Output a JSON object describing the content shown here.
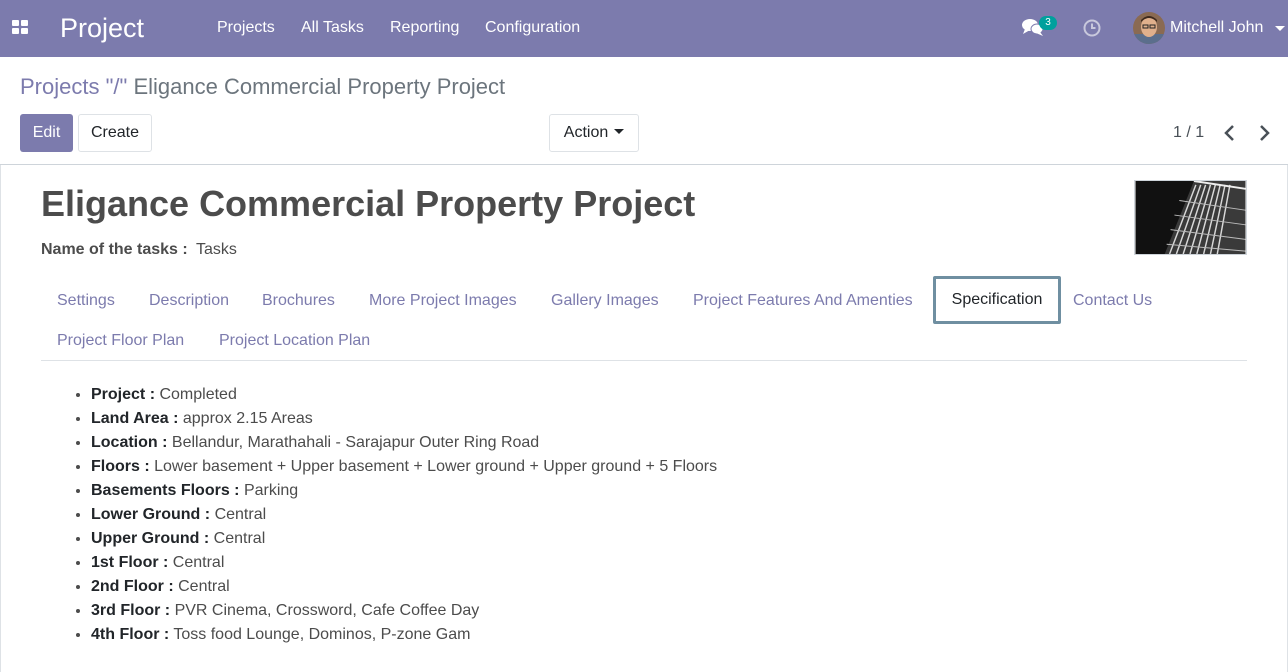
{
  "navbar": {
    "brand": "Project",
    "menus": [
      "Projects",
      "All Tasks",
      "Reporting",
      "Configuration"
    ],
    "message_count": "3",
    "user_name": "Mitchell John"
  },
  "breadcrumb": {
    "parent": "Projects",
    "separator": "\"/\"",
    "current": "Eligance Commercial Property Project"
  },
  "buttons": {
    "edit": "Edit",
    "create": "Create",
    "action": "Action"
  },
  "pager": {
    "value": "1 / 1"
  },
  "record": {
    "title": "Eligance Commercial Property Project",
    "task_label": "Name of the tasks :",
    "task_value": "Tasks"
  },
  "tabs": [
    "Settings",
    "Description",
    "Brochures",
    "More Project Images",
    "Gallery Images",
    "Project Features And Amenties",
    "Specification",
    "Contact Us",
    "Project Floor Plan",
    "Project Location Plan"
  ],
  "active_tab": "Specification",
  "specifications": [
    {
      "label": "Project :",
      "value": "Completed"
    },
    {
      "label": "Land Area :",
      "value": "approx 2.15 Areas"
    },
    {
      "label": "Location :",
      "value": "Bellandur, Marathahali - Sarajapur Outer Ring Road"
    },
    {
      "label": "Floors :",
      "value": "Lower basement + Upper basement + Lower ground + Upper ground + 5 Floors"
    },
    {
      "label": "Basements Floors :",
      "value": "Parking"
    },
    {
      "label": "Lower Ground :",
      "value": "Central"
    },
    {
      "label": "Upper Ground :",
      "value": "Central"
    },
    {
      "label": "1st Floor :",
      "value": "Central"
    },
    {
      "label": "2nd Floor :",
      "value": "Central"
    },
    {
      "label": "3rd Floor :",
      "value": "PVR Cinema, Crossword, Cafe Coffee Day"
    },
    {
      "label": "4th Floor :",
      "value": "Toss food Lounge, Dominos, P-zone Gam"
    }
  ],
  "colors": {
    "navbar": "#7c7bad",
    "accent": "#7c7bad",
    "badge": "#00a09d",
    "active_tab_border": "#6f8fa1"
  }
}
